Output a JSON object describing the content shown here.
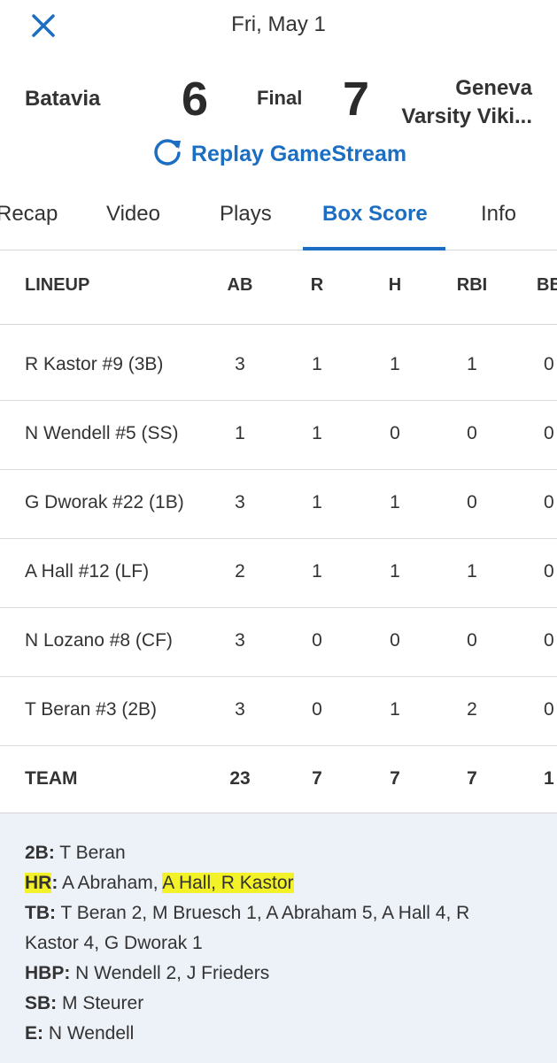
{
  "header": {
    "date": "Fri, May 1"
  },
  "score": {
    "home_team": "Batavia",
    "home_score": "6",
    "status": "Final",
    "away_score": "7",
    "away_team_line1": "Geneva",
    "away_team_line2": "Varsity Viki..."
  },
  "replay": {
    "label": "Replay GameStream"
  },
  "tabs": [
    {
      "label": "Recap"
    },
    {
      "label": "Video"
    },
    {
      "label": "Plays"
    },
    {
      "label": "Box Score"
    },
    {
      "label": "Info"
    }
  ],
  "table": {
    "columns": [
      "LINEUP",
      "AB",
      "R",
      "H",
      "RBI",
      "BB"
    ],
    "rows": [
      [
        "R Kastor #9 (3B)",
        "3",
        "1",
        "1",
        "1",
        "0"
      ],
      [
        "N Wendell #5 (SS)",
        "1",
        "1",
        "0",
        "0",
        "0"
      ],
      [
        "G Dworak #22 (1B)",
        "3",
        "1",
        "1",
        "0",
        "0"
      ],
      [
        "A Hall #12 (LF)",
        "2",
        "1",
        "1",
        "1",
        "0"
      ],
      [
        "N Lozano #8 (CF)",
        "3",
        "0",
        "0",
        "0",
        "0"
      ],
      [
        "T Beran #3 (2B)",
        "3",
        "0",
        "1",
        "2",
        "0"
      ]
    ],
    "team": [
      "TEAM",
      "23",
      "7",
      "7",
      "7",
      "1"
    ]
  },
  "notes": {
    "b2_label": "2B:",
    "b2_value": " T Beran",
    "hr_label": "HR",
    "hr_colon": ":",
    "hr_value_a": " A Abraham, ",
    "hr_value_b": "A Hall, R Kastor",
    "tb_label": "TB:",
    "tb_value_line1": " T Beran 2, M Bruesch 1, A Abraham 5, A Hall 4, R",
    "tb_value_line2": "Kastor 4, G Dworak 1",
    "hbp_label": "HBP:",
    "hbp_value": " N Wendell 2, J Frieders",
    "sb_label": "SB:",
    "sb_value": " M Steurer",
    "e_label": "E:",
    "e_value": " N Wendell"
  },
  "colors": {
    "accent": "#1b6ec2",
    "highlight": "#f3f127",
    "notes_bg": "#edf1f8"
  }
}
